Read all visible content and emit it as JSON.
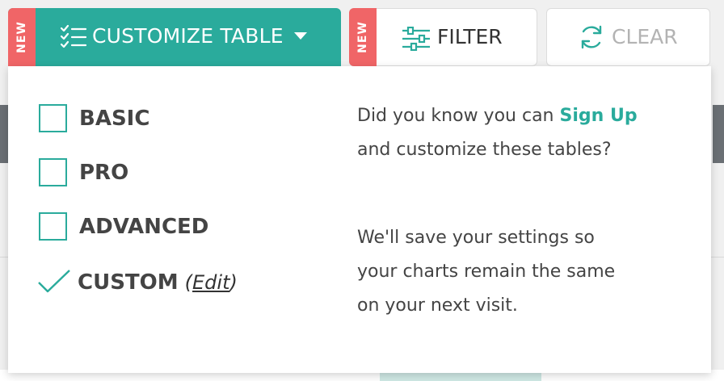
{
  "colors": {
    "accent": "#2aab9c",
    "new_tag": "#f06567",
    "text": "#444444",
    "disabled": "#b3b3b3"
  },
  "toolbar": {
    "customize": {
      "new_badge": "NEW",
      "label": "CUSTOMIZE TABLE",
      "icon": "checklist-icon",
      "caret_icon": "caret-down-icon"
    },
    "filter": {
      "new_badge": "NEW",
      "label": "FILTER",
      "icon": "sliders-icon"
    },
    "clear": {
      "label": "CLEAR",
      "icon": "refresh-icon",
      "disabled": true
    }
  },
  "dropdown": {
    "options": [
      {
        "label": "BASIC",
        "checked": false
      },
      {
        "label": "PRO",
        "checked": false
      },
      {
        "label": "ADVANCED",
        "checked": false
      },
      {
        "label": "CUSTOM",
        "checked": true,
        "edit_label": "Edit"
      }
    ],
    "info": {
      "line1_prefix": "Did you know you can",
      "signup_link": "Sign Up",
      "line1_suffix": "and customize these tables?",
      "line2": "We'll save your settings so your charts remain the same on your next visit."
    }
  }
}
